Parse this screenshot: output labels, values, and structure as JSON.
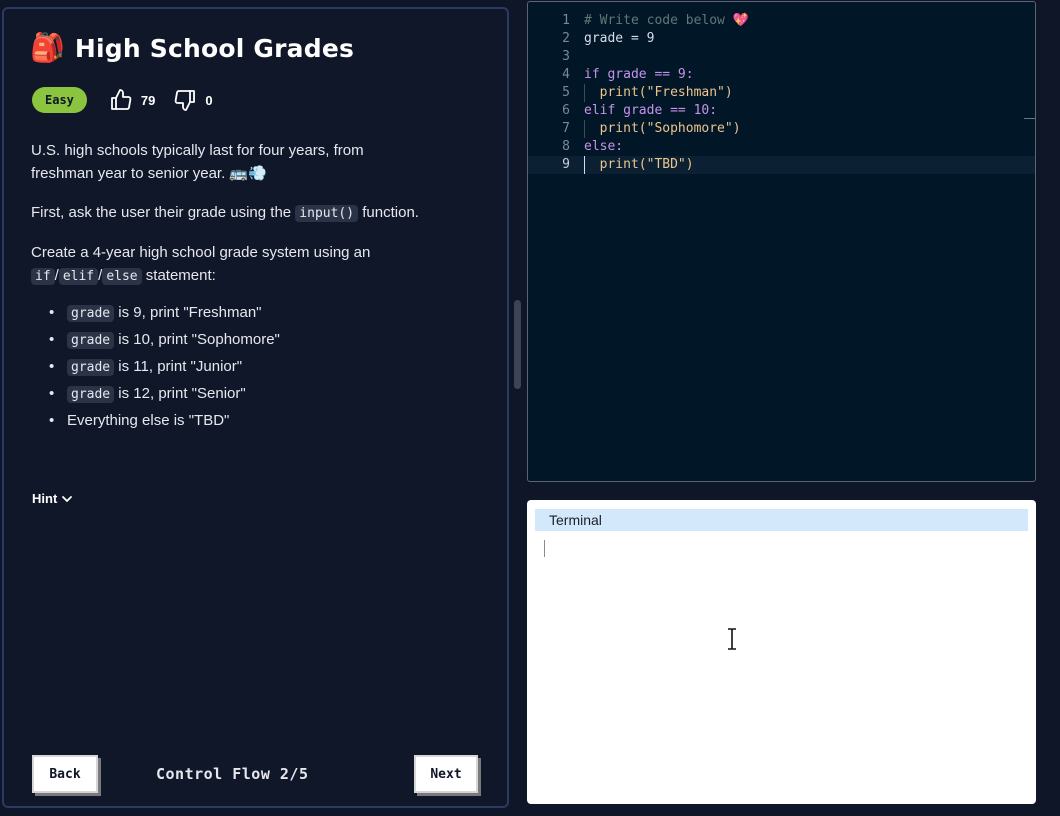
{
  "lesson": {
    "emoji": "🎒",
    "title": "High School Grades",
    "difficulty": "Easy",
    "likes": "79",
    "dislikes": "0",
    "intro_line1": "U.S. high schools typically last for four years, from",
    "intro_line2": "freshman year to senior year. 🚌💨",
    "instruction_pre": "First, ask the user their grade using the ",
    "instruction_code": "input()",
    "instruction_post": " function.",
    "task_line1": "Create a 4-year high school grade system using an",
    "task_code_if": "if",
    "task_sep1": "/",
    "task_code_elif": "elif",
    "task_sep2": "/",
    "task_code_else": "else",
    "task_post": " statement:",
    "requirements": [
      {
        "code": "grade",
        "text": " is 9, print \"Freshman\""
      },
      {
        "code": "grade",
        "text": " is 10, print \"Sophomore\""
      },
      {
        "code": "grade",
        "text": " is 11, print \"Junior\""
      },
      {
        "code": "grade",
        "text": " is 12, print \"Senior\""
      },
      {
        "code": "",
        "text": "Everything else is \"TBD\""
      }
    ],
    "hint_label": "Hint"
  },
  "footer": {
    "back_label": "Back",
    "progress_label": "Control Flow 2/5",
    "next_label": "Next"
  },
  "editor": {
    "lines": [
      {
        "n": "1",
        "text": "# Write code below 💖"
      },
      {
        "n": "2",
        "text": "grade = 9"
      },
      {
        "n": "3",
        "text": ""
      },
      {
        "n": "4",
        "text": "if grade == 9:"
      },
      {
        "n": "5",
        "text": "  print(\"Freshman\")"
      },
      {
        "n": "6",
        "text": "elif grade == 10:"
      },
      {
        "n": "7",
        "text": "  print(\"Sophomore\")"
      },
      {
        "n": "8",
        "text": "else:"
      },
      {
        "n": "9",
        "text": "  print(\"TBD\")"
      }
    ],
    "active_line": "9"
  },
  "terminal": {
    "title": "Terminal"
  },
  "colors": {
    "background": "#0f1627",
    "accent_easy": "#8bc43f",
    "editor_bg": "#011627",
    "terminal_header": "#d3e9fb"
  },
  "icons": {
    "like": "thumbs-up-icon",
    "dislike": "thumbs-down-icon",
    "hint": "chevron-down-icon"
  }
}
